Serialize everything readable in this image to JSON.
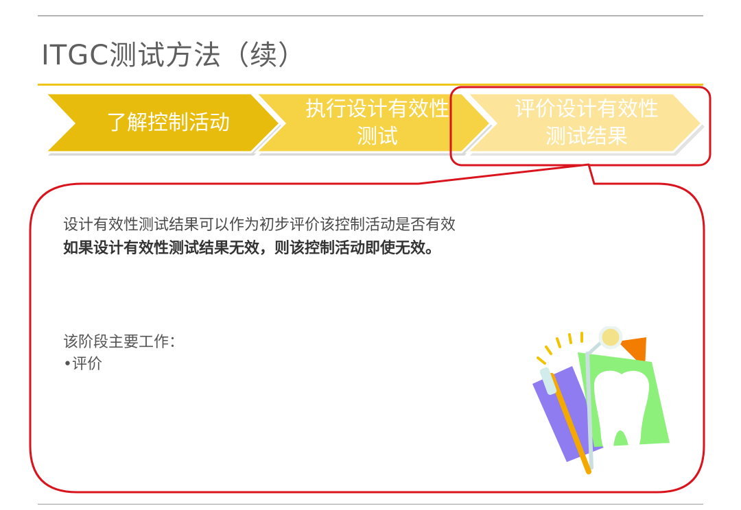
{
  "slide": {
    "title": "ITGC测试方法（续）"
  },
  "steps": [
    {
      "label": "了解控制活动",
      "color": "#e8bc0c"
    },
    {
      "line1": "执行设计有效性",
      "line2": "测试",
      "color": "#f6d245"
    },
    {
      "line1": "评价设计有效性",
      "line2": "测试结果",
      "color": "#fce49a",
      "highlighted": true
    }
  ],
  "callout": {
    "border_color": "#d9141c",
    "line1": "设计有效性测试结果可以作为初步评价该控制活动是否有效",
    "line2": "如果设计有效性测试结果无效，则该控制活动即使无效。",
    "work_heading": "该阶段主要工作：",
    "work_item": "•评价"
  },
  "clipart": {
    "icon": "dental-care-icon"
  }
}
